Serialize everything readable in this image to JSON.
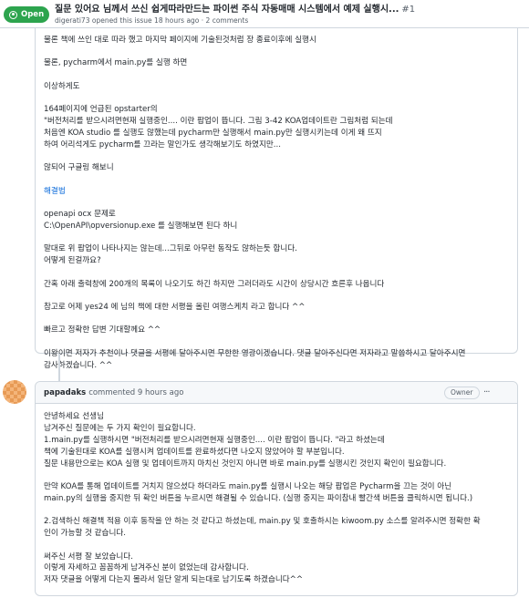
{
  "issue": {
    "status": "Open",
    "title": "질문 있어요 님께서 쓰신 쉽게따라만드는 파이썬 주식 자동매매 시스템에서 예제 실행시...",
    "number": "#1",
    "meta": "digerati73 opened this issue 18 hours ago · 2 comments"
  },
  "comment1": {
    "lines": [
      "물론 책에 쓰인 대로 따라 했고 마지막 페이지에 기술된것처럼 장 종료이후에 실행시",
      "",
      "물론, pycharm에서 main.py를 실행 하면",
      "",
      "이상하게도",
      "",
      "164페이지에 언급된 opstarter의",
      "\"버전처리를 받으시려면현재 실행중인.... 이란 팝업이 뜹니다. 그림 3-42 KOA업데이트란 그림처럼 되는데",
      "처음엔 KOA studio 를 실행도 않했는데 pycharm만 실행해서 main.py만 실행시키는데 이게 왜 뜨지",
      "하여 어리석게도 pycharm를 끄라는 말인가도 생각해보기도 하였지만...",
      "",
      "않되어 구글링 해보니",
      "",
      "해결법",
      "",
      "openapi ocx 문제로",
      "C:\\OpenAPI\\opversionup.exe 를 실행해보면 된다 하니",
      "",
      "말대로 위 팝업이 나타나지는 않는데...그뒤로 아무런 동작도 않하는듯 합니다.",
      "어떻게 된걸까요?",
      "",
      "간혹 아래 출력창에 200개의 목록이 나오기도 하긴 하지만 그러더라도 시간이 상당시간 흐른후 나옵니다",
      "",
      "참고로 어제 yes24 에 님의 책에 대한 서평을 올린 여행스케치 라고 합니다 ^^",
      "",
      "빠르고 정확한 답변 기대할께요 ^^",
      "",
      "이왕이면 저자가 추천이나 댓글을 서평에 달아주시면 무한한 영광이겠습니다. 댓글 달아주신다면 저자라고 말씀하시고 달아주시면",
      "감사하겠습니다. ^^"
    ]
  },
  "comment2": {
    "author": "papadaks",
    "time": "commented 9 hours ago",
    "badge": "Owner",
    "menu": "···",
    "lines": [
      "안녕하세요 선생님",
      "남겨주신 질문에는 두 가지 확인이 필요합니다.",
      "1.main.py를 실행하시면 \"버전처리를 받으시려면현재 실행중인.... 이란 팝업이 뜹니다. \"라고 하셨는데",
      "책에 기술된대로 KOA를 실행시켜 업데이트를 완료하셨다면 나오지 않았어야 할 부분입니다.",
      "질문 내용만으로는 KOA 실행 및 업데이트까지 마치신 것인지 아니면 바로 main.py를 실행시킨 것인지 확인이 필요합니다.",
      "",
      "만약 KOA를 통해 업데이트를 거치지 않으셨다 하더라도 main.py를 실행시 나오는 해당 팝업은 Pycharm을 끄는 것이 아닌",
      "main.py의 실행을 중지한 뒤 확인 버튼을 누르시면 해결될 수 있습니다. (실행 중지는 파이참내 빨간색 버튼을 클릭하시면 됩니다.)",
      "",
      "2.검색하신 해결책 적용 이후 동작을 안 하는 것 같다고 하셨는데, main.py 및 호출하시는 kiwoom.py 소스를 알려주시면 정확한 확",
      "인이 가능할 것 같습니다.",
      "",
      "써주신 서평 잘 보았습니다.",
      "이렇게 자세하고 꼼꼼하게 남겨주신 분이 없었는데 감사합니다.",
      "저자 댓글을 어떻게 다는지 몰라서 일단 알게 되는대로 남기도록 하겠습니다^^"
    ]
  }
}
